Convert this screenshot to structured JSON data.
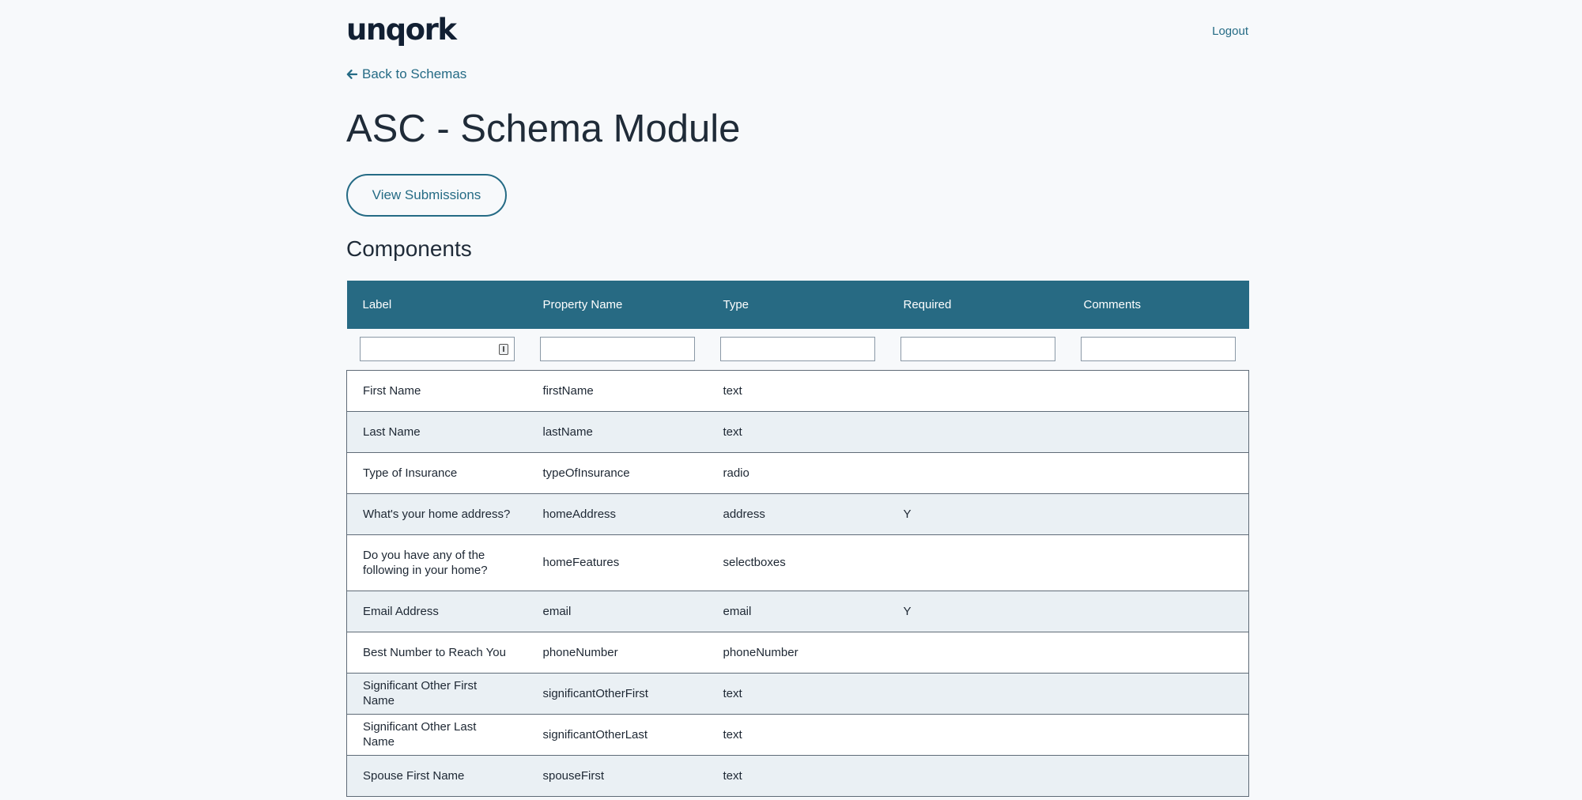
{
  "header": {
    "logo": "unqork",
    "logout_label": "Logout"
  },
  "nav": {
    "back_label": "Back to Schemas",
    "back_icon": "arrow-left-icon"
  },
  "page": {
    "title": "ASC - Schema Module",
    "view_submissions_label": "View Submissions",
    "section_title": "Components"
  },
  "colors": {
    "accent": "#256b85",
    "header_bg": "#276a83",
    "stripe": "#eaf0f4",
    "page_bg": "#f7f9fb"
  },
  "table": {
    "columns": [
      "Label",
      "Property Name",
      "Type",
      "Required",
      "Comments"
    ],
    "filters": [
      "",
      "",
      "",
      "",
      ""
    ],
    "rows": [
      [
        "First Name",
        "firstName",
        "text",
        "",
        ""
      ],
      [
        "Last Name",
        "lastName",
        "text",
        "",
        ""
      ],
      [
        "Type of Insurance",
        "typeOfInsurance",
        "radio",
        "",
        ""
      ],
      [
        "What's your home address?",
        "homeAddress",
        "address",
        "Y",
        ""
      ],
      [
        "Do you have any of the following in your home?",
        "homeFeatures",
        "selectboxes",
        "",
        ""
      ],
      [
        "Email Address",
        "email",
        "email",
        "Y",
        ""
      ],
      [
        "Best Number to Reach You",
        "phoneNumber",
        "phoneNumber",
        "",
        ""
      ],
      [
        "Significant Other First Name",
        "significantOtherFirst",
        "text",
        "",
        ""
      ],
      [
        "Significant Other Last Name",
        "significantOtherLast",
        "text",
        "",
        ""
      ],
      [
        "Spouse First Name",
        "spouseFirst",
        "text",
        "",
        ""
      ]
    ]
  }
}
